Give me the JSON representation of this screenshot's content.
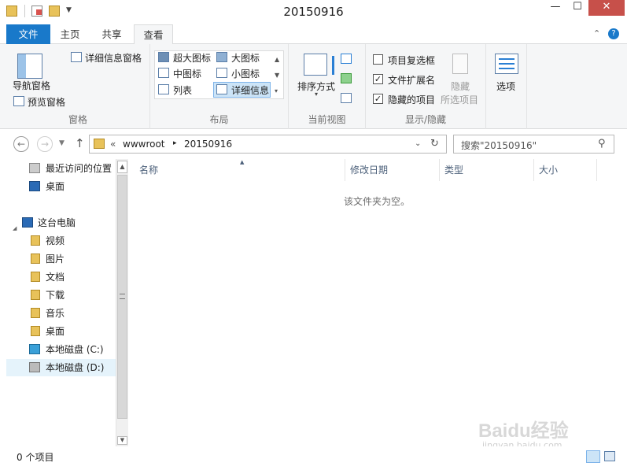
{
  "window": {
    "title": "20150916",
    "minimize": "—",
    "maximize": "☐",
    "close": "✕"
  },
  "tabs": {
    "file": "文件",
    "home": "主页",
    "share": "共享",
    "view": "查看"
  },
  "ribbon": {
    "panes": {
      "nav_pane": "导航窗格",
      "preview_pane": "预览窗格",
      "details_pane": "详细信息窗格",
      "group": "窗格"
    },
    "layout": {
      "extra_large": "超大图标",
      "large": "大图标",
      "medium": "中图标",
      "small": "小图标",
      "list": "列表",
      "details": "详细信息",
      "group": "布局"
    },
    "current_view": {
      "sort_by": "排序方式",
      "group": "当前视图"
    },
    "show_hide": {
      "item_checkboxes": "项目复选框",
      "file_extensions": "文件扩展名",
      "hidden_items": "隐藏的项目",
      "hide": "隐藏",
      "hide_selected": "所选项目",
      "group": "显示/隐藏",
      "item_checkboxes_checked": false,
      "file_extensions_checked": true,
      "hidden_items_checked": true
    },
    "options": {
      "label": "选项"
    }
  },
  "address": {
    "prefix": "«",
    "crumb1": "wwwroot",
    "sep": "▸",
    "crumb2": "20150916"
  },
  "search": {
    "placeholder": "搜索\"20150916\""
  },
  "nav": {
    "recent": "最近访问的位置",
    "desktop1": "桌面",
    "this_pc": "这台电脑",
    "videos": "视频",
    "pictures": "图片",
    "documents": "文档",
    "downloads": "下载",
    "music": "音乐",
    "desktop2": "桌面",
    "drive_c": "本地磁盘 (C:)",
    "drive_d": "本地磁盘 (D:)"
  },
  "columns": {
    "name": "名称",
    "date": "修改日期",
    "type": "类型",
    "size": "大小"
  },
  "empty_message": "该文件夹为空。",
  "status": {
    "count": "0 个项目"
  },
  "watermark": {
    "brand": "Baidu经验",
    "url": "jingyan.baidu.com"
  }
}
